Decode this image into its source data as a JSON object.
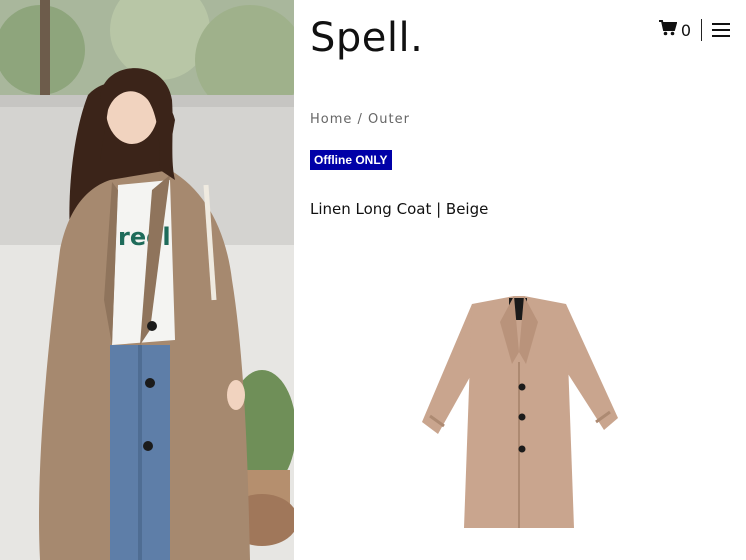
{
  "brand": {
    "logo": "Spell."
  },
  "header": {
    "cart_icon": "shopping-cart-icon",
    "cart_count": "0",
    "menu_icon": "hamburger-menu-icon"
  },
  "breadcrumb": {
    "home": "Home",
    "separator": " / ",
    "category": "Outer"
  },
  "badge": {
    "label": "Offline ONLY",
    "bg": "#0000a8",
    "fg": "#ffffff"
  },
  "product": {
    "title": "Linen Long Coat | Beige",
    "color_swatch": "#c9a58e"
  },
  "lifestyle_photo": {
    "shirt_text": "reel"
  }
}
